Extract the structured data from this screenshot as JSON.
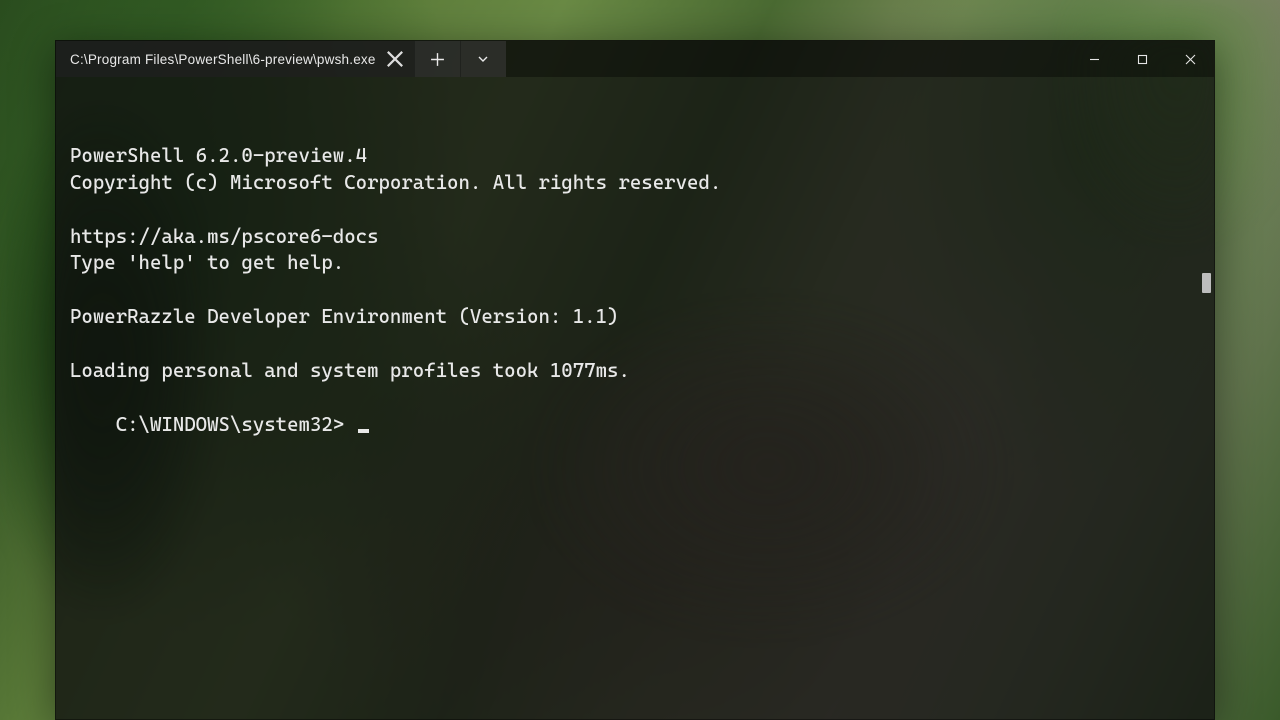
{
  "window": {
    "tab_title": "C:\\Program Files\\PowerShell\\6-preview\\pwsh.exe",
    "new_tab_icon": "plus-icon",
    "dropdown_icon": "chevron-down-icon"
  },
  "terminal": {
    "lines": [
      "PowerShell 6.2.0-preview.4",
      "Copyright (c) Microsoft Corporation. All rights reserved.",
      "",
      "https://aka.ms/pscore6-docs",
      "Type 'help' to get help.",
      "",
      "PowerRazzle Developer Environment (Version: 1.1)",
      "",
      "Loading personal and system profiles took 1077ms."
    ],
    "prompt": "C:\\WINDOWS\\system32> "
  }
}
